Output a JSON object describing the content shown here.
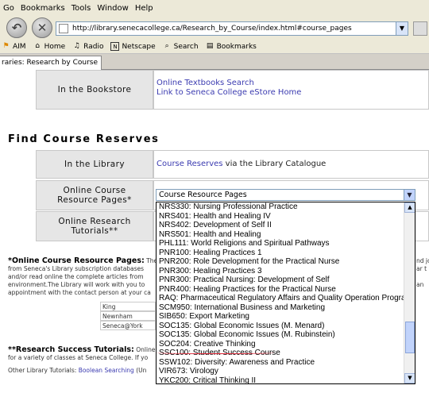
{
  "menu": [
    "Go",
    "Bookmarks",
    "Tools",
    "Window",
    "Help"
  ],
  "url": "http://library.senecacollege.ca/Research_by_Course/index.html#course_pages",
  "bookmarks": [
    {
      "label": "AIM",
      "icon": "aim-icon"
    },
    {
      "label": "Home",
      "icon": "home-icon"
    },
    {
      "label": "Radio",
      "icon": "radio-icon"
    },
    {
      "label": "Netscape",
      "icon": "netscape-icon"
    },
    {
      "label": "Search",
      "icon": "search-icon"
    },
    {
      "label": "Bookmarks",
      "icon": "folder-icon"
    }
  ],
  "tab_title": "raries: Research by Course",
  "bookstore": {
    "label": "In the Bookstore",
    "link1": "Online Textbooks Search",
    "link2": "Link to Seneca College eStore Home"
  },
  "section_title": "Find Course Reserves",
  "library": {
    "label": "In the Library",
    "link": "Course Reserves",
    "suffix": " via the Library Catalogue"
  },
  "online_pages_label_line1": "Online Course",
  "online_pages_label_line2": "Resource Pages*",
  "research_tutorials_label_line1": "Online Research",
  "research_tutorials_label_line2": "Tutorials**",
  "select_value": "Course Resource Pages",
  "dropdown_options": [
    "NRS330: Nursing Professional Practice",
    "NRS401: Health and Healing IV",
    "NRS402: Development of Self II",
    "NRS501: Health and Healing",
    "PHL111: World Religions and Spiritual Pathways",
    "PNR100: Healing Practices 1",
    "PNR200: Role Development for the Practical Nurse",
    "PNR300: Healing Practices 3",
    "PNR300: Practical Nursing: Development of Self",
    "PNR400: Healing Practices for the Practical Nurse",
    "RAQ: Pharmaceutical Regulatory Affairs and Quality Operation Program",
    "SCM950: International Business and Marketing",
    "SIB650: Export Marketing",
    "SOC135: Global Economic Issues (M. Menard)",
    "SOC135: Global Economic Issues (M. Rubinstein)",
    "SOC204: Creative Thinking",
    "SSC100: Student Success Course",
    "SSW102: Diversity: Awareness and Practice",
    "VIR673: Virology",
    "YKC200: Critical Thinking II"
  ],
  "footnote1_title": "*Online Course Resource Pages:",
  "footnote1_lines": [
    "The",
    "from Seneca's Library subscription databases",
    "and/or read online the complete articles from",
    "environment.The Library will work with you to",
    "appointment with the contact person at your ca"
  ],
  "footnote1_right": [
    "nd jo",
    "ar t",
    "an"
  ],
  "campuses": [
    "King",
    "Newnham",
    "Seneca@York"
  ],
  "footnote2_title": "**Research Success Tutorials:",
  "footnote2_line1": "Online",
  "footnote2_line2": "for a variety of classes at Seneca College. If yo",
  "other_tutorials_label": "Other Library Tutorials:",
  "other_tutorials_link": "Boolean Searching",
  "other_tutorials_suffix": "(Un"
}
